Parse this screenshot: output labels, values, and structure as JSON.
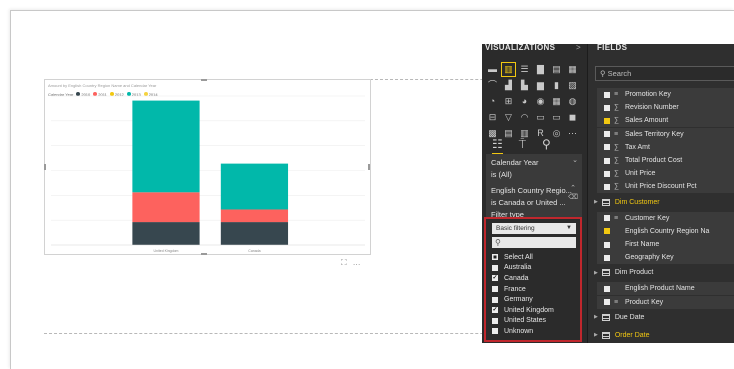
{
  "report": {
    "chart_title": "Amount by English Country Region Name and Calendar Year",
    "legend_label": "Calendar Year",
    "legend_items": [
      {
        "label": "2010",
        "color": "#37474f"
      },
      {
        "label": "2011",
        "color": "#fd625e"
      },
      {
        "label": "2012",
        "color": "#f2c80f"
      },
      {
        "label": "2013",
        "color": "#01b8aa"
      },
      {
        "label": "2014",
        "color": "#f5d33f"
      }
    ],
    "more_icon": "…",
    "focus_icon": "⛶"
  },
  "chart_data": {
    "type": "bar",
    "stacked": true,
    "categories": [
      "United Kingdom",
      "Canada"
    ],
    "series": [
      {
        "name": "2011",
        "color": "#37474f",
        "values": [
          2.0,
          2.0
        ]
      },
      {
        "name": "2012",
        "color": "#fd625e",
        "values": [
          2.6,
          1.1
        ]
      },
      {
        "name": "2013",
        "color": "#01b8aa",
        "values": [
          8.0,
          4.0
        ]
      }
    ],
    "ylim": [
      0,
      13
    ],
    "grid": true,
    "legend": "top-left"
  },
  "viz_panel": {
    "title": "VISUALIZATIONS",
    "arrow": ">",
    "icons": [
      "▬",
      "▥",
      "☰",
      "▇",
      "▤",
      "▦",
      "⌒",
      "▟",
      "▙",
      "▆",
      "▮",
      "▨",
      "◔",
      "⊞",
      "◕",
      "◉",
      "▦",
      "◍",
      "⊟",
      "▽",
      "◠",
      "▭",
      "▭",
      "◼",
      "▩",
      "▤",
      "▥",
      "R",
      "◎",
      "⋯"
    ],
    "tabs": [
      "fields-tab-icon",
      "format-tab-icon",
      "analytics-tab-icon"
    ],
    "filters": [
      {
        "line1": "Calendar Year",
        "line2": "is (All)"
      },
      {
        "line1": "English Country Regio...",
        "line2": "is Canada or United ...",
        "line3": "Filter type"
      }
    ],
    "filter_type": "Basic filtering",
    "options": [
      {
        "label": "Select All",
        "state": "partial"
      },
      {
        "label": "Australia",
        "state": "off"
      },
      {
        "label": "Canada",
        "state": "on"
      },
      {
        "label": "France",
        "state": "off"
      },
      {
        "label": "Germany",
        "state": "off"
      },
      {
        "label": "United Kingdom",
        "state": "on"
      },
      {
        "label": "United States",
        "state": "off"
      },
      {
        "label": "Unknown",
        "state": "off"
      }
    ]
  },
  "fields_panel": {
    "title": "FIELDS",
    "search_placeholder": "Search",
    "rows": [
      {
        "kind": "item",
        "label": "Promotion Key",
        "checked": false,
        "icon": "field"
      },
      {
        "kind": "item",
        "label": "Revision Number",
        "checked": false,
        "icon": "sigma"
      },
      {
        "kind": "item",
        "label": "Sales Amount",
        "checked": true,
        "icon": "sigma"
      },
      {
        "kind": "item",
        "label": "Sales Territory Key",
        "checked": false,
        "icon": "field"
      },
      {
        "kind": "item",
        "label": "Tax Amt",
        "checked": false,
        "icon": "sigma"
      },
      {
        "kind": "item",
        "label": "Total Product Cost",
        "checked": false,
        "icon": "sigma"
      },
      {
        "kind": "item",
        "label": "Unit Price",
        "checked": false,
        "icon": "sigma"
      },
      {
        "kind": "item",
        "label": "Unit Price Discount Pct",
        "checked": false,
        "icon": "sigma"
      },
      {
        "kind": "group",
        "label": "Dim Customer",
        "highlight": true
      },
      {
        "kind": "item",
        "label": "Customer Key",
        "checked": false,
        "icon": "field"
      },
      {
        "kind": "item",
        "label": "English Country Region Na",
        "checked": true,
        "icon": "none"
      },
      {
        "kind": "item",
        "label": "First Name",
        "checked": false,
        "icon": "none"
      },
      {
        "kind": "item",
        "label": "Geography Key",
        "checked": false,
        "icon": "none"
      },
      {
        "kind": "group",
        "label": "Dim Product",
        "highlight": false
      },
      {
        "kind": "item",
        "label": "English Product Name",
        "checked": false,
        "icon": "none"
      },
      {
        "kind": "item",
        "label": "Product Key",
        "checked": false,
        "icon": "field"
      },
      {
        "kind": "group",
        "label": "Due Date",
        "highlight": false
      },
      {
        "kind": "group",
        "label": "Order Date",
        "highlight": true
      }
    ]
  }
}
